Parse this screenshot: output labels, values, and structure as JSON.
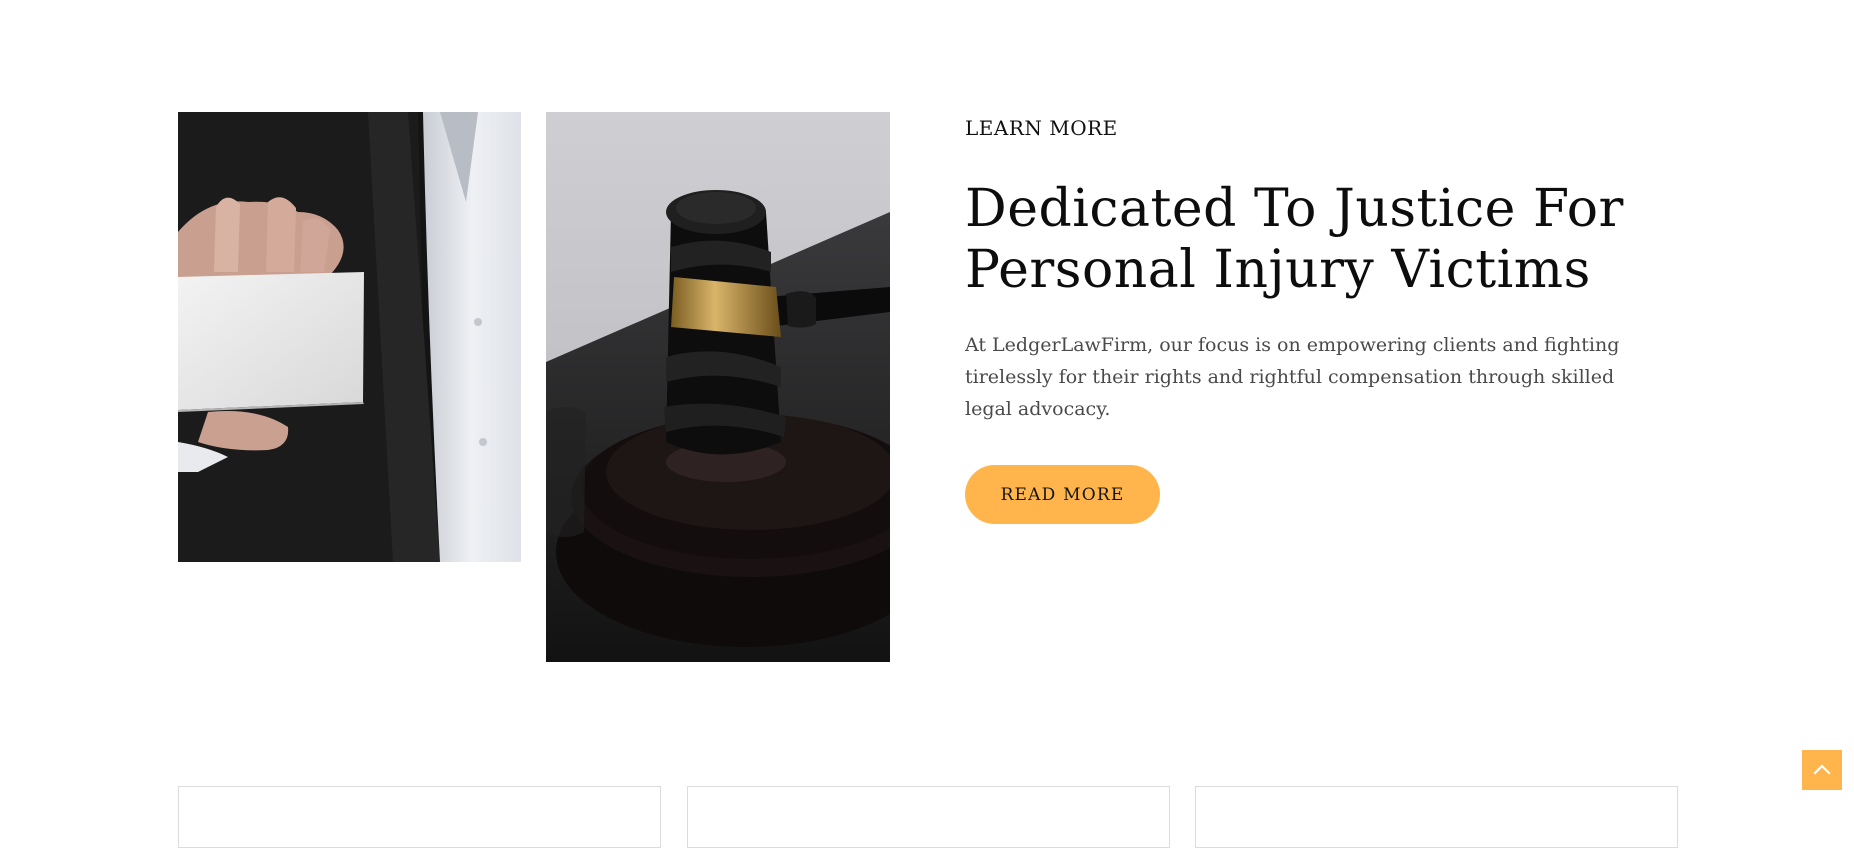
{
  "hero": {
    "eyebrow": "LEARN MORE",
    "title_line1": "Dedicated To Justice For",
    "title_line2": "Personal Injury Victims",
    "description": "At LedgerLawFirm, our focus is on empowering clients and fighting tirelessly for their rights and rightful compensation through skilled legal advocacy.",
    "button_label": "READ MORE"
  },
  "colors": {
    "accent": "#ffb54b",
    "heading": "#0d0d0d",
    "body_text": "#4a4a4a",
    "card_border": "#dcdcdc"
  },
  "images": {
    "left": "business-card-photo",
    "right": "gavel-photo"
  },
  "icons": {
    "back_to_top": "chevron-up-icon"
  }
}
